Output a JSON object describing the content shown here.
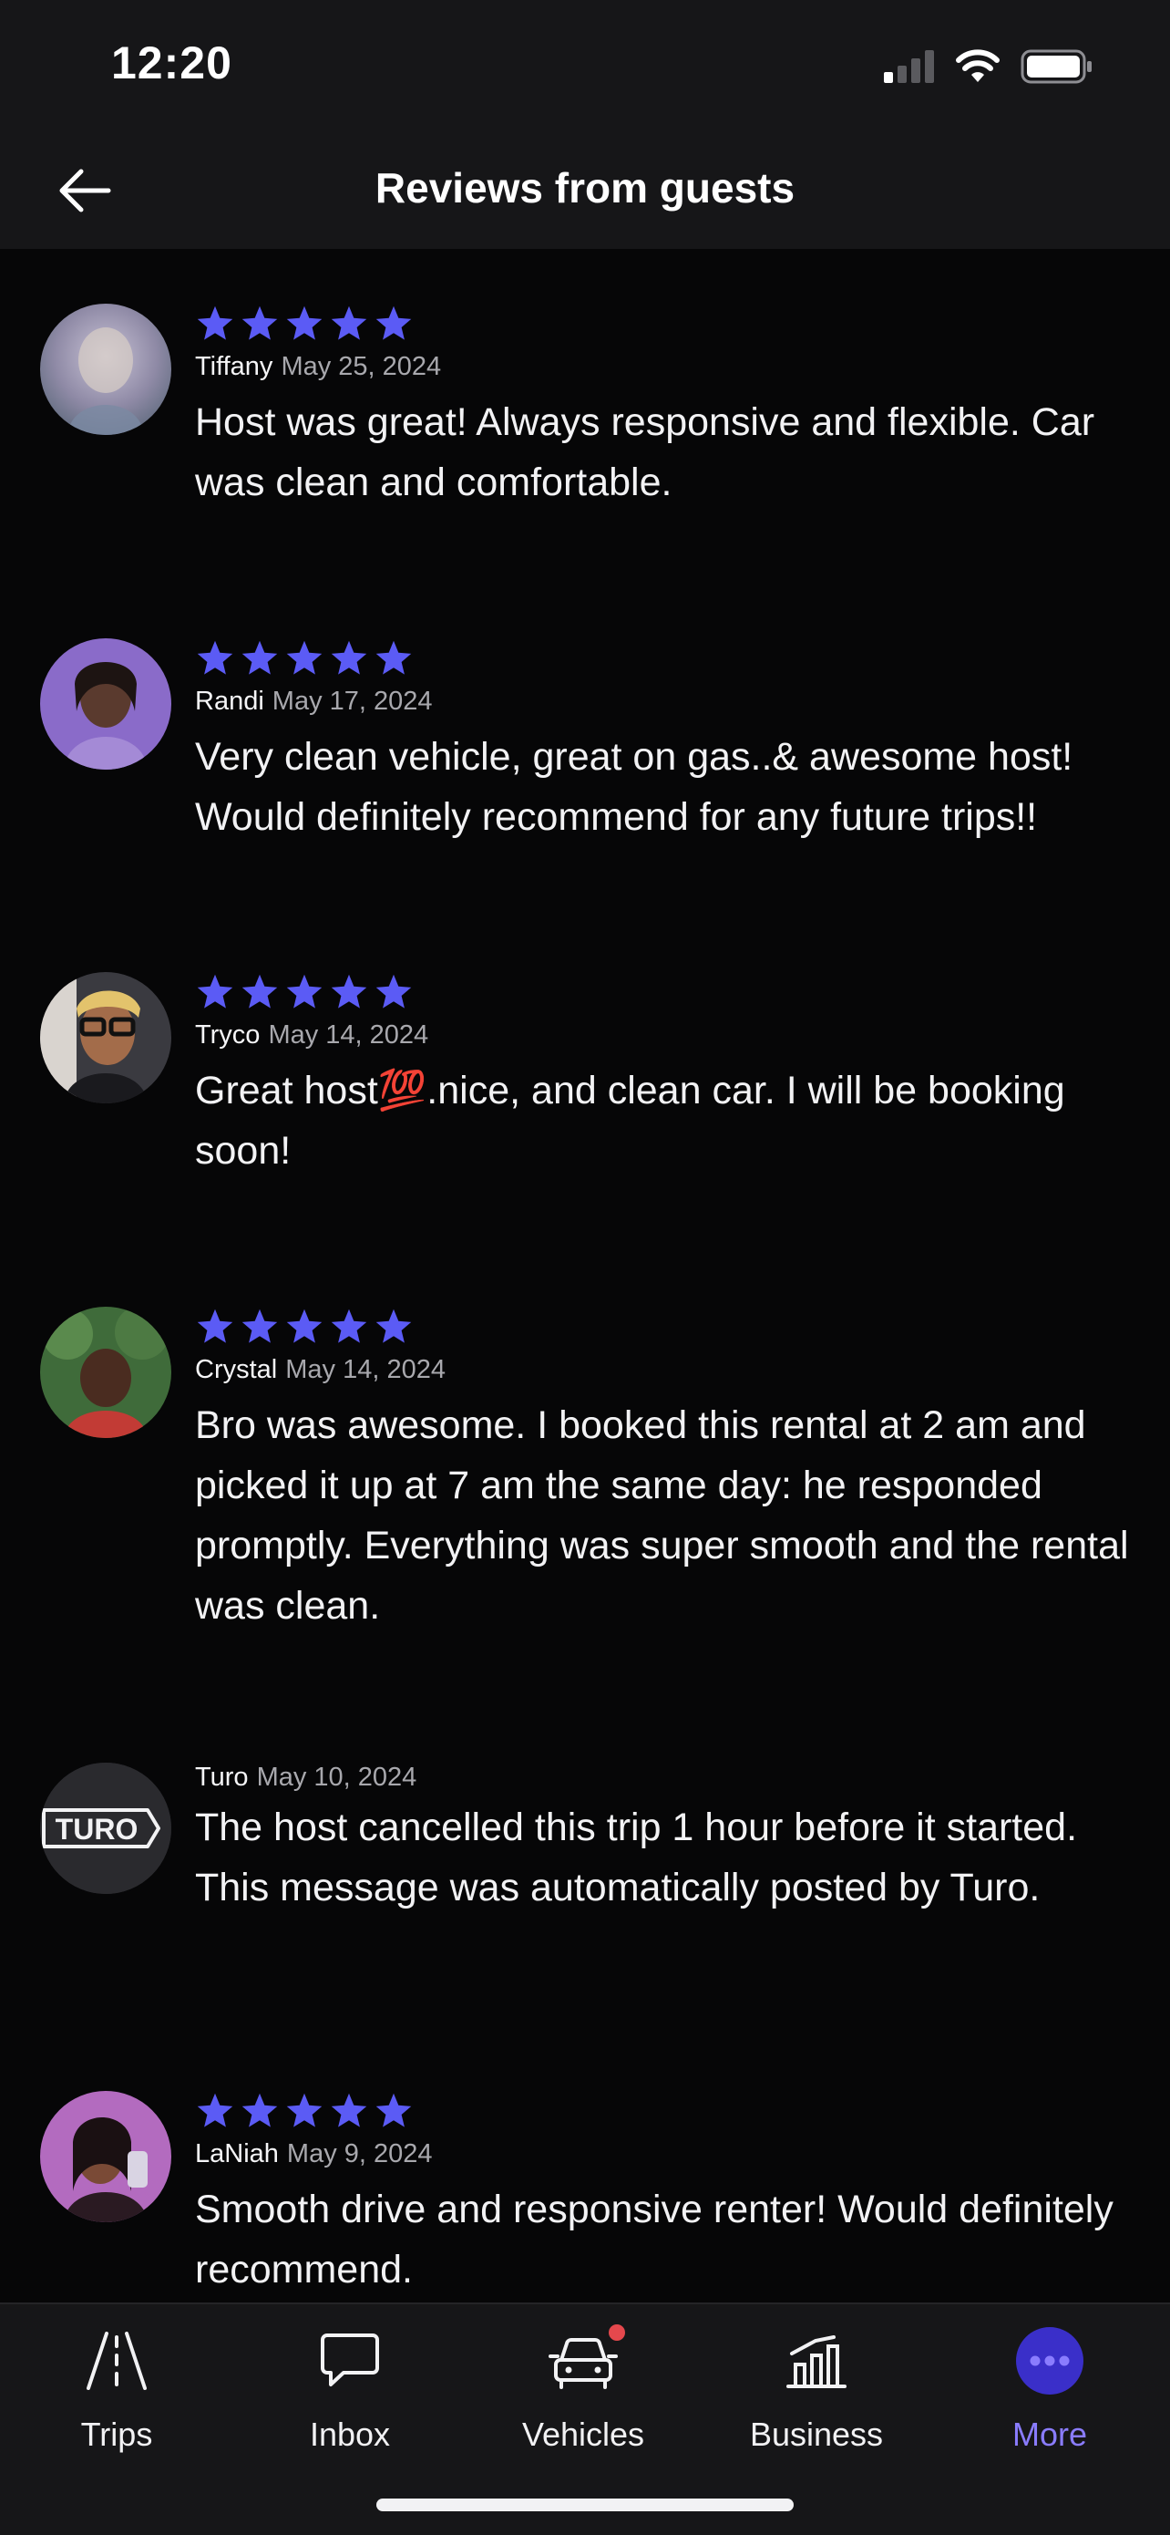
{
  "status_bar": {
    "time": "12:20"
  },
  "header": {
    "title": "Reviews from guests"
  },
  "colors": {
    "accent": "#5b5bf5",
    "active_tab": "#8a7cff",
    "background": "#060607",
    "bar": "#161618",
    "badge": "#e5484d"
  },
  "reviews": [
    {
      "name": "Tiffany",
      "date": "May 25, 2024",
      "rating": 5,
      "text": "Host was great! Always responsive and flexible. Car was clean and comfortable."
    },
    {
      "name": "Randi",
      "date": "May 17, 2024",
      "rating": 5,
      "text": "Very clean vehicle, great on gas..& awesome host! Would definitely recommend for any future trips!!"
    },
    {
      "name": "Tryco",
      "date": "May 14, 2024",
      "rating": 5,
      "text": "Great host💯.nice, and clean car. I will be booking soon!"
    },
    {
      "name": "Crystal",
      "date": "May 14, 2024",
      "rating": 5,
      "text": "Bro was awesome. I booked this rental at 2 am and picked it up at 7 am the same day: he responded promptly. Everything was super smooth and the rental was clean."
    },
    {
      "name": "Turo",
      "date": "May 10, 2024",
      "avatar_text": "TURO",
      "text": "The host cancelled this trip 1 hour before it started. This message was automatically posted by Turo."
    },
    {
      "name": "LaNiah",
      "date": "May 9, 2024",
      "rating": 5,
      "text": "Smooth drive and responsive renter! Would definitely recommend."
    }
  ],
  "tabs": [
    {
      "label": "Trips",
      "icon": "road-icon"
    },
    {
      "label": "Inbox",
      "icon": "chat-bubble-icon"
    },
    {
      "label": "Vehicles",
      "icon": "car-icon",
      "badge": true
    },
    {
      "label": "Business",
      "icon": "bar-chart-icon"
    },
    {
      "label": "More",
      "icon": "more-dots-icon",
      "active": true
    }
  ]
}
